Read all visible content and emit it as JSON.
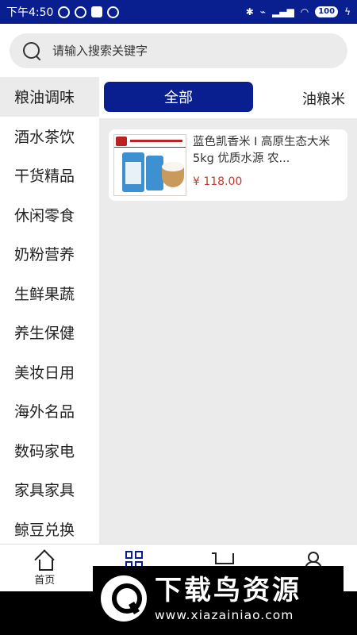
{
  "status_bar": {
    "time": "下午4:50",
    "battery": "100"
  },
  "search": {
    "placeholder": "请输入搜索关键字"
  },
  "sidebar": {
    "items": [
      {
        "label": "粮油调味",
        "active": true
      },
      {
        "label": "酒水茶饮"
      },
      {
        "label": "干货精品"
      },
      {
        "label": "休闲零食"
      },
      {
        "label": "奶粉营养"
      },
      {
        "label": "生鲜果蔬"
      },
      {
        "label": "养生保健"
      },
      {
        "label": "美妆日用"
      },
      {
        "label": "海外名品"
      },
      {
        "label": "数码家电"
      },
      {
        "label": "家具家具"
      },
      {
        "label": "鲸豆兑换"
      }
    ]
  },
  "tabs": {
    "active": "全部",
    "next": "油粮米"
  },
  "products": [
    {
      "title": "蓝色凯香米 I  高原生态大米 5kg 优质水源 农...",
      "price": "¥ 118.00"
    }
  ],
  "bottom_nav": {
    "home_label": "首页"
  },
  "watermark": {
    "title": "下载鸟资源",
    "url": "www.xiazainiao.com"
  },
  "colors": {
    "brand": "#0a1f8f",
    "price": "#c0392b",
    "panel_bg": "#ebebeb"
  }
}
